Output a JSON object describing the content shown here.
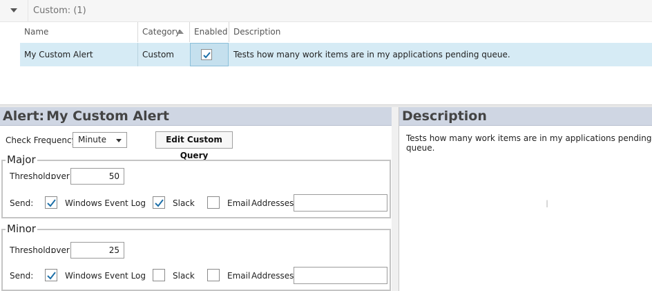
{
  "group": {
    "label": "Custom: (1)"
  },
  "columns": {
    "name": "Name",
    "category": "Category",
    "enabled": "Enabled",
    "description": "Description"
  },
  "row": {
    "name": "My Custom Alert",
    "category": "Custom",
    "enabled": true,
    "description": "Tests how many work items are in my applications pending queue."
  },
  "alert_panel": {
    "title_prefix": "Alert:",
    "title_name": "My Custom Alert",
    "check_frequency_label": "Check Frequency:",
    "check_frequency_value": "Minute",
    "edit_query_button": "Edit Custom Query"
  },
  "major": {
    "title": "Major",
    "threshold_label": "Threshold:",
    "over_label": "over",
    "threshold_value": "50",
    "send_label": "Send:",
    "windows_event_log_label": "Windows Event Log",
    "windows_event_log_checked": true,
    "slack_label": "Slack",
    "slack_checked": true,
    "email_label": "Email",
    "email_checked": false,
    "addresses_label": "Addresses:",
    "addresses_value": ""
  },
  "minor": {
    "title": "Minor",
    "threshold_label": "Threshold:",
    "over_label": "over",
    "threshold_value": "25",
    "send_label": "Send:",
    "windows_event_log_label": "Windows Event Log",
    "windows_event_log_checked": true,
    "slack_label": "Slack",
    "slack_checked": false,
    "email_label": "Email",
    "email_checked": false,
    "addresses_label": "Addresses:",
    "addresses_value": ""
  },
  "description_panel": {
    "title": "Description",
    "text": "Tests how many work items are in my applications pending queue."
  },
  "colors": {
    "accent": "#1c6fa8",
    "selection": "#d6ebf5",
    "panel_header": "#cfd6e3"
  }
}
